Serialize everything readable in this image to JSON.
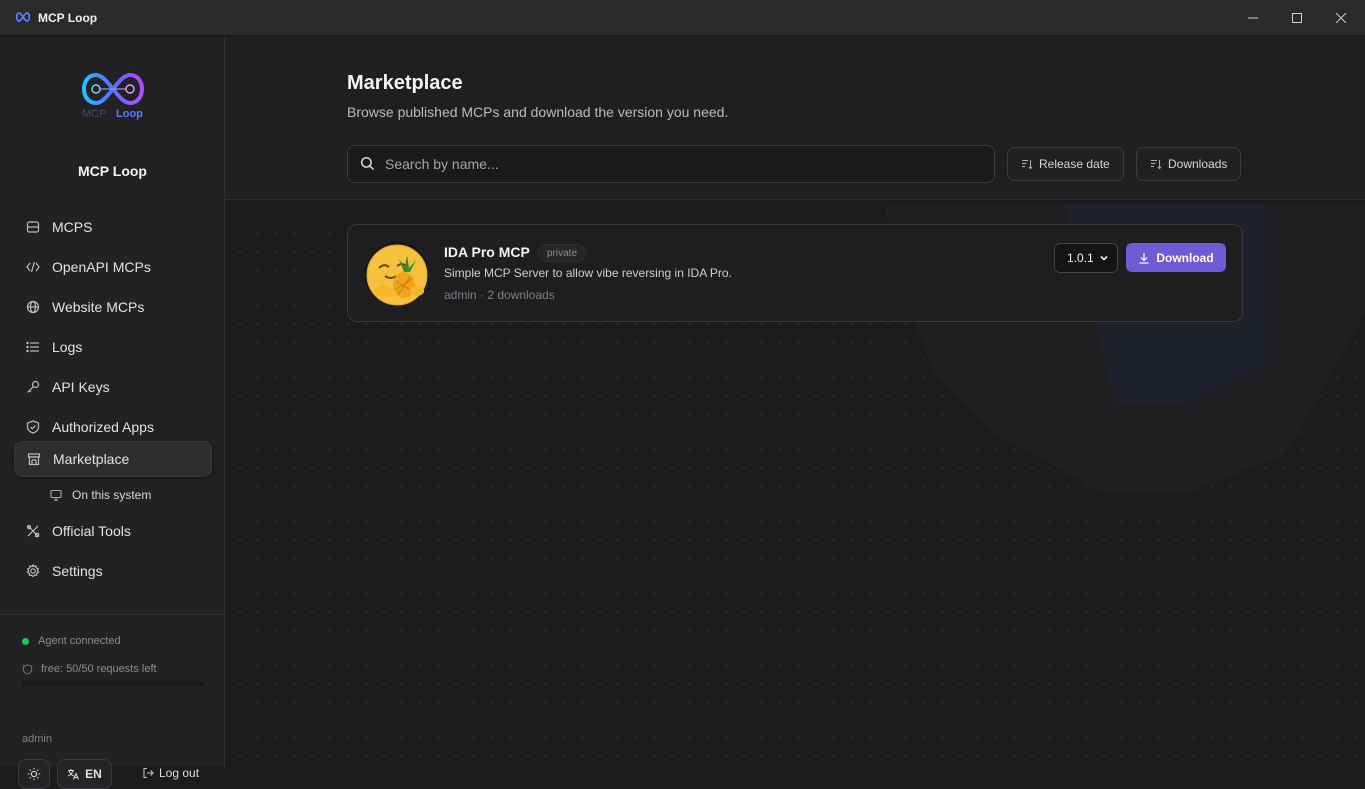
{
  "window": {
    "title": "MCP Loop"
  },
  "sidebar": {
    "brand": "MCP Loop",
    "logo_text": "MCP Loop",
    "items": [
      {
        "label": "MCPS",
        "icon": "database-icon"
      },
      {
        "label": "OpenAPI MCPs",
        "icon": "code-icon"
      },
      {
        "label": "Website MCPs",
        "icon": "globe-icon"
      },
      {
        "label": "Logs",
        "icon": "list-icon"
      },
      {
        "label": "API Keys",
        "icon": "key-icon"
      },
      {
        "label": "Authorized Apps",
        "icon": "shield-check-icon"
      },
      {
        "label": "Marketplace",
        "icon": "store-icon",
        "active": true
      },
      {
        "label": "Official Tools",
        "icon": "tools-icon"
      },
      {
        "label": "Settings",
        "icon": "gear-icon"
      }
    ],
    "sub_item": {
      "label": "On this system",
      "icon": "monitor-icon"
    },
    "footer": {
      "status": "Agent connected",
      "quota": "free: 50/50 requests left",
      "quota_used_fraction": 0,
      "user": "admin",
      "language": "EN",
      "logout": "Log out"
    }
  },
  "main": {
    "title": "Marketplace",
    "subtitle": "Browse published MCPs and download the version you need.",
    "search": {
      "placeholder": "Search by name..."
    },
    "sort_buttons": [
      "Release date",
      "Downloads"
    ],
    "cards": [
      {
        "name": "IDA Pro MCP",
        "badge": "private",
        "description": "Simple MCP Server to allow vibe reversing in IDA Pro.",
        "meta": "admin · 2 downloads",
        "version": "1.0.1",
        "download_label": "Download"
      }
    ]
  },
  "colors": {
    "accent": "#6e5bd6",
    "status_ok": "#22c55e",
    "background": "#1b1b1d",
    "sidebar": "#222224"
  }
}
